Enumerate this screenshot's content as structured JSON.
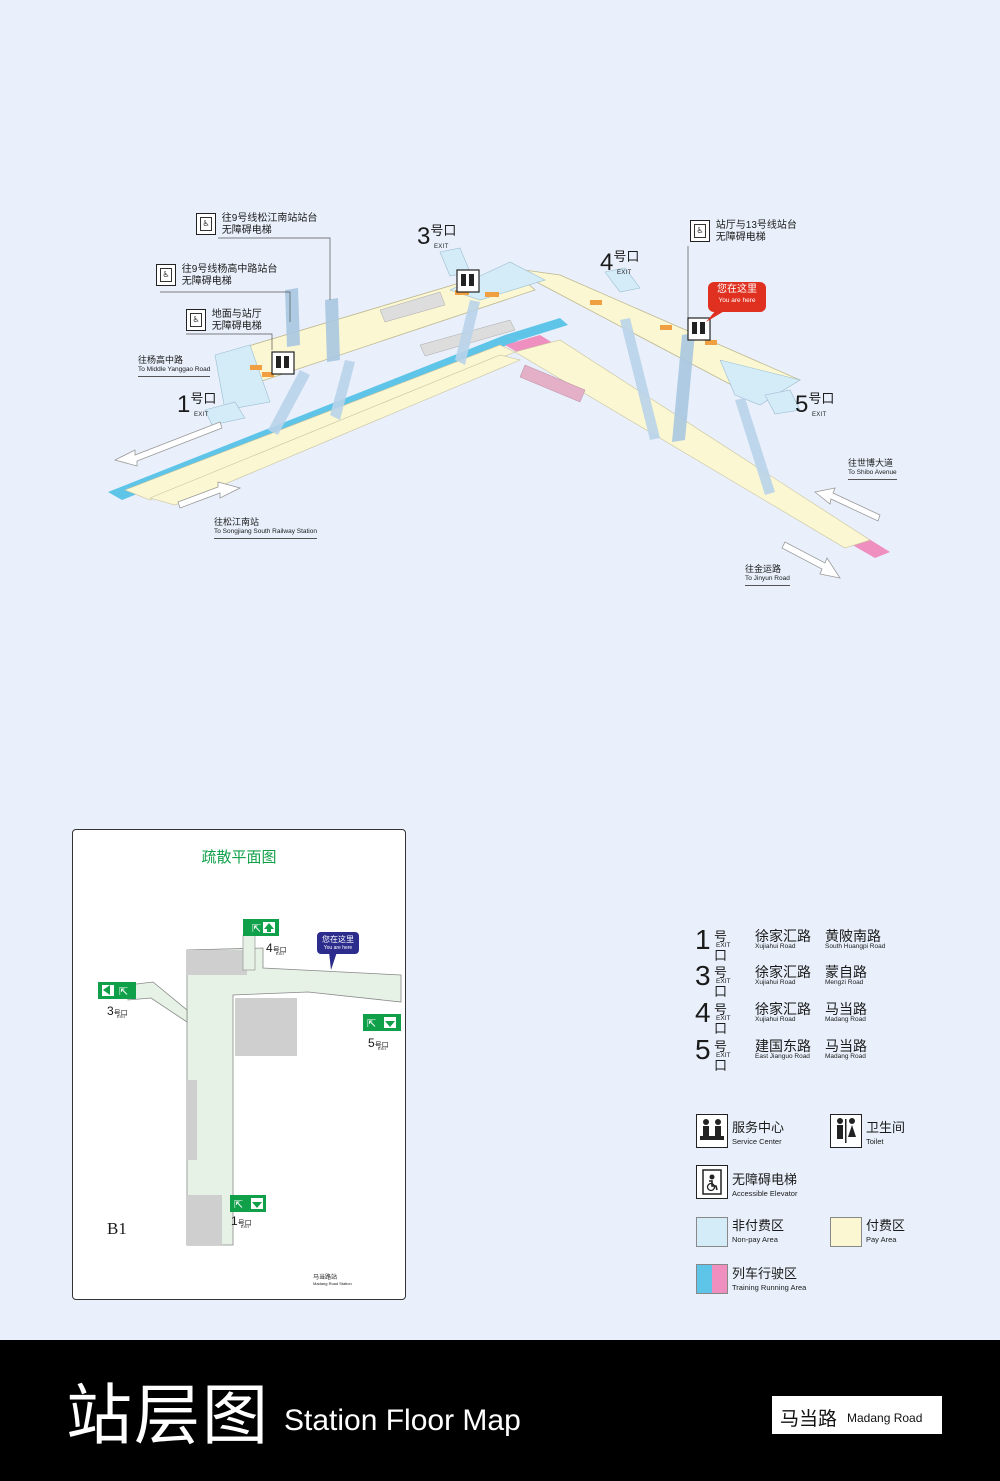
{
  "callouts": [
    {
      "zh1": "往9号线松江南站站台",
      "zh2": "无障碍电梯"
    },
    {
      "zh1": "往9号线杨高中路站台",
      "zh2": "无障碍电梯"
    },
    {
      "zh1": "地面与站厅",
      "zh2": "无障碍电梯"
    },
    {
      "zh1": "站厅与13号线站台",
      "zh2": "无障碍电梯"
    }
  ],
  "exits": [
    {
      "num": "1",
      "zh": "号口",
      "en": "EXIT"
    },
    {
      "num": "3",
      "zh": "号口",
      "en": "EXIT"
    },
    {
      "num": "4",
      "zh": "号口",
      "en": "EXIT"
    },
    {
      "num": "5",
      "zh": "号口",
      "en": "EXIT"
    }
  ],
  "you_are_here": {
    "zh": "您在这里",
    "en": "You are here"
  },
  "directions": [
    {
      "zh": "往杨高中路",
      "en": "To Middle Yanggao Road"
    },
    {
      "zh": "往松江南站",
      "en": "To Songjiang South Railway Station"
    },
    {
      "zh": "往世博大道",
      "en": "To Shibo Avenue"
    },
    {
      "zh": "往金运路",
      "en": "To Jinyun Road"
    }
  ],
  "evac": {
    "title": "疏散平面图",
    "level": "B1",
    "station_zh": "马当路站",
    "station_en": "Madang Road Station",
    "you_are_here_zh": "您在这里",
    "you_are_here_en": "You are here",
    "exit_nums": [
      "4",
      "3",
      "5",
      "1"
    ],
    "hk": "号口",
    "exit_en": "EXIT"
  },
  "exit_legend": [
    {
      "num": "1",
      "zh": "号口",
      "en": "EXIT",
      "r1": "徐家汇路",
      "r1e": "Xujiahui Road",
      "r2": "黄陂南路",
      "r2e": "South Huangpi Road"
    },
    {
      "num": "3",
      "zh": "号口",
      "en": "EXIT",
      "r1": "徐家汇路",
      "r1e": "Xujiahui Road",
      "r2": "蒙自路",
      "r2e": "Mengzi Road"
    },
    {
      "num": "4",
      "zh": "号口",
      "en": "EXIT",
      "r1": "徐家汇路",
      "r1e": "Xujiahui Road",
      "r2": "马当路",
      "r2e": "Madang Road"
    },
    {
      "num": "5",
      "zh": "号口",
      "en": "EXIT",
      "r1": "建国东路",
      "r1e": "East Jianguo Road",
      "r2": "马当路",
      "r2e": "Madang Road"
    }
  ],
  "legend": {
    "service_zh": "服务中心",
    "service_en": "Service Center",
    "toilet_zh": "卫生间",
    "toilet_en": "Toilet",
    "elevator_zh": "无障碍电梯",
    "elevator_en": "Accessible Elevator",
    "nonpay_zh": "非付费区",
    "nonpay_en": "Non-pay Area",
    "pay_zh": "付费区",
    "pay_en": "Pay Area",
    "track_zh": "列车行驶区",
    "track_en": "Training Running Area"
  },
  "footer": {
    "title_zh": "站层图",
    "title_en": "Station Floor Map",
    "station_zh": "马当路",
    "station_en": "Madang Road"
  },
  "colors": {
    "nonpay": "#d4ebf8",
    "pay": "#fbf7d2",
    "track_blue": "#5ec4e8",
    "track_pink": "#ef8fbf",
    "exit_green": "#10a04a",
    "you_red": "#e03020",
    "you_navy": "#2b2c8c"
  }
}
